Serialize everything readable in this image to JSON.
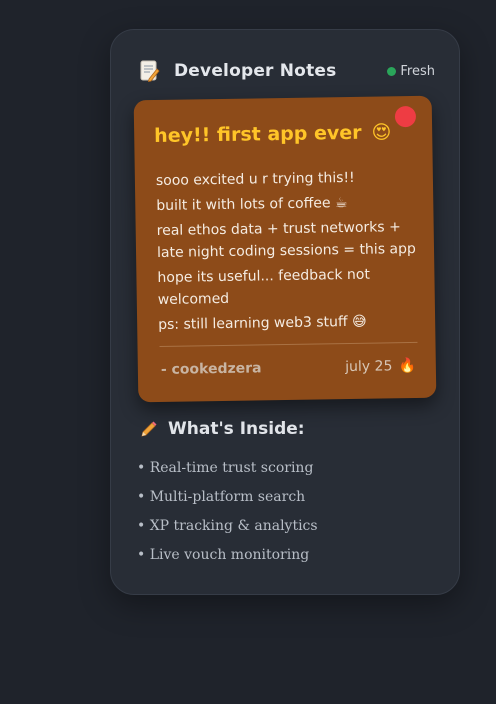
{
  "header": {
    "title": "Developer Notes",
    "status": "Fresh",
    "icon": "document-icon"
  },
  "note": {
    "title": "hey!! first app ever",
    "title_emoji": "😍",
    "lines": [
      "sooo excited u r trying this!!",
      "built it with lots of coffee ☕",
      "real ethos data + trust networks + late night coding sessions = this app",
      "hope its useful... feedback not welcomed",
      "ps: still learning web3 stuff 😅"
    ],
    "author": "- cookedzera",
    "date": "july 25",
    "date_emoji": "🔥"
  },
  "inside": {
    "title": "What's Inside:",
    "icon": "pencil-icon",
    "items": [
      "• Real-time trust scoring",
      "• Multi-platform search",
      "• XP tracking & analytics",
      "• Live vouch monitoring"
    ]
  },
  "colors": {
    "background": "#1f232b",
    "card": "#282d36",
    "note": "#8d4b19",
    "note_title": "#ffc528",
    "pin": "#ee3c43",
    "status_dot": "#2aa55a"
  }
}
